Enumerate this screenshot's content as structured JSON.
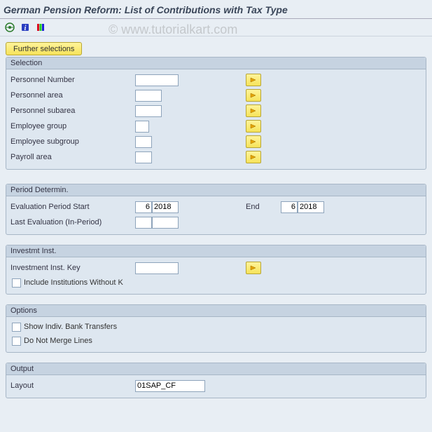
{
  "title": "German Pension Reform: List of Contributions with Tax Type",
  "watermark": "© www.tutorialkart.com",
  "toolbar": {
    "further_selections": "Further selections"
  },
  "selection": {
    "header": "Selection",
    "fields": {
      "personnel_number": "Personnel Number",
      "personnel_area": "Personnel area",
      "personnel_subarea": "Personnel subarea",
      "employee_group": "Employee group",
      "employee_subgroup": "Employee subgroup",
      "payroll_area": "Payroll area"
    }
  },
  "period": {
    "header": "Period Determin.",
    "eval_start_label": "Evaluation Period Start",
    "eval_start_month": "6",
    "eval_start_year": "2018",
    "end_label": "End",
    "end_month": "6",
    "end_year": "2018",
    "last_eval_label": "Last Evaluation (In-Period)",
    "last_eval_month": "",
    "last_eval_year": ""
  },
  "investmt": {
    "header": "Investmt Inst.",
    "key_label": "Investment Inst. Key",
    "include_label": "Include Institutions Without K"
  },
  "options": {
    "header": "Options",
    "show_indiv": "Show Indiv. Bank Transfers",
    "no_merge": "Do Not Merge Lines"
  },
  "output": {
    "header": "Output",
    "layout_label": "Layout",
    "layout_value": "01SAP_CF"
  }
}
